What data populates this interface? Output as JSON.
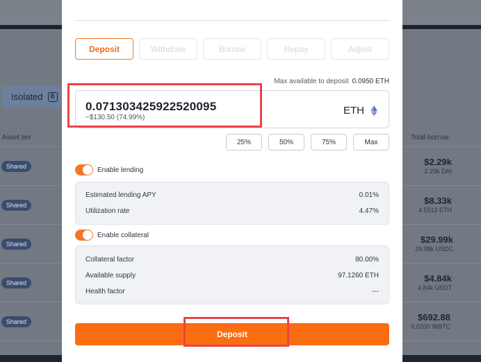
{
  "background": {
    "isolated_label": "Isolated",
    "isolated_count": "0",
    "col_asset_tier": "Asset tier",
    "col_total_borrow": "Total borrow",
    "rows": [
      {
        "tier": "Shared",
        "borrow_usd": "$2.29k",
        "borrow_amount": "2.29k DAI"
      },
      {
        "tier": "Shared",
        "borrow_usd": "$8.33k",
        "borrow_amount": "4.5512 ETH"
      },
      {
        "tier": "Shared",
        "borrow_usd": "$29.99k",
        "borrow_amount": "29.98k USDC"
      },
      {
        "tier": "Shared",
        "borrow_usd": "$4.84k",
        "borrow_amount": "4.84k USDT"
      },
      {
        "tier": "Shared",
        "borrow_usd": "$692.88",
        "borrow_amount": "0.0200 WBTC"
      }
    ]
  },
  "modal": {
    "tabs": [
      "Deposit",
      "Withdraw",
      "Borrow",
      "Repay",
      "Adjust"
    ],
    "active_tab": "Deposit",
    "max_available_label": "Max available to deposit",
    "max_available_value": "0.0950 ETH",
    "amount_value": "0.071303425922520095",
    "amount_usd": "~$130.50 (74.99%)",
    "token_symbol": "ETH",
    "token_icon": "ethereum-icon",
    "percent_buttons": [
      "25%",
      "50%",
      "75%",
      "Max"
    ],
    "enable_lending_label": "Enable lending",
    "lending_info": [
      {
        "label": "Estimated lending APY",
        "value": "0.01%"
      },
      {
        "label": "Utilization rate",
        "value": "4.47%"
      }
    ],
    "enable_collateral_label": "Enable collateral",
    "collateral_info": [
      {
        "label": "Collateral factor",
        "value": "80.00%"
      },
      {
        "label": "Available supply",
        "value": "97.1260 ETH"
      },
      {
        "label": "Health factor",
        "value": "---"
      }
    ],
    "submit_label": "Deposit"
  },
  "colors": {
    "accent": "#fb6d11",
    "highlight": "#e8434a"
  }
}
